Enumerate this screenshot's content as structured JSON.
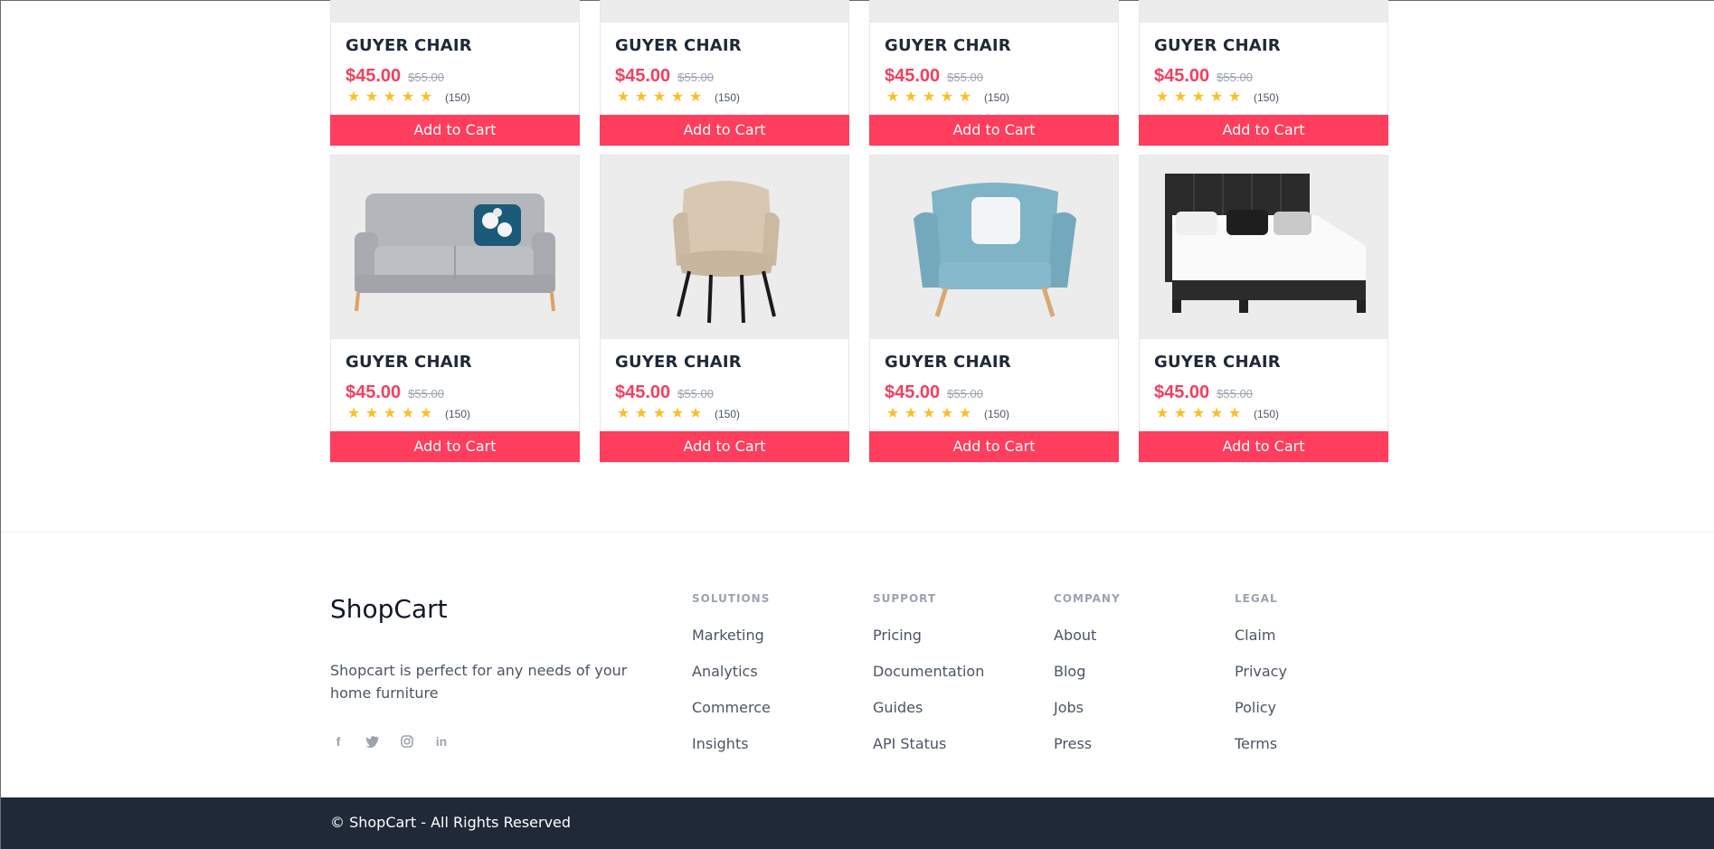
{
  "products": [
    {
      "title": "GUYER CHAIR",
      "price": "$45.00",
      "old_price": "$55.00",
      "reviews": "(150)",
      "cta": "Add to Cart",
      "image": "chair"
    },
    {
      "title": "GUYER CHAIR",
      "price": "$45.00",
      "old_price": "$55.00",
      "reviews": "(150)",
      "cta": "Add to Cart",
      "image": "chair"
    },
    {
      "title": "GUYER CHAIR",
      "price": "$45.00",
      "old_price": "$55.00",
      "reviews": "(150)",
      "cta": "Add to Cart",
      "image": "chair"
    },
    {
      "title": "GUYER CHAIR",
      "price": "$45.00",
      "old_price": "$55.00",
      "reviews": "(150)",
      "cta": "Add to Cart",
      "image": "chair"
    },
    {
      "title": "GUYER CHAIR",
      "price": "$45.00",
      "old_price": "$55.00",
      "reviews": "(150)",
      "cta": "Add to Cart",
      "image": "grey-sofa"
    },
    {
      "title": "GUYER CHAIR",
      "price": "$45.00",
      "old_price": "$55.00",
      "reviews": "(150)",
      "cta": "Add to Cart",
      "image": "beige-chair"
    },
    {
      "title": "GUYER CHAIR",
      "price": "$45.00",
      "old_price": "$55.00",
      "reviews": "(150)",
      "cta": "Add to Cart",
      "image": "blue-armchair"
    },
    {
      "title": "GUYER CHAIR",
      "price": "$45.00",
      "old_price": "$55.00",
      "reviews": "(150)",
      "cta": "Add to Cart",
      "image": "black-bed"
    }
  ],
  "rating": {
    "stars": 5,
    "max": 5
  },
  "colors": {
    "accent": "#ff3d5c",
    "price": "#f43f5e",
    "star": "#fbbf24",
    "footer_bg": "#1f2937"
  },
  "footer": {
    "brand": "ShopCart",
    "tagline": "Shopcart is perfect for any needs of your home furniture",
    "socials": [
      "facebook-icon",
      "twitter-icon",
      "instagram-icon",
      "linkedin-icon"
    ],
    "columns": [
      {
        "heading": "SOLUTIONS",
        "links": [
          "Marketing",
          "Analytics",
          "Commerce",
          "Insights"
        ]
      },
      {
        "heading": "SUPPORT",
        "links": [
          "Pricing",
          "Documentation",
          "Guides",
          "API Status"
        ]
      },
      {
        "heading": "COMPANY",
        "links": [
          "About",
          "Blog",
          "Jobs",
          "Press"
        ]
      },
      {
        "heading": "LEGAL",
        "links": [
          "Claim",
          "Privacy",
          "Policy",
          "Terms"
        ]
      }
    ],
    "copyright": "© ShopCart - All Rights Reserved"
  }
}
